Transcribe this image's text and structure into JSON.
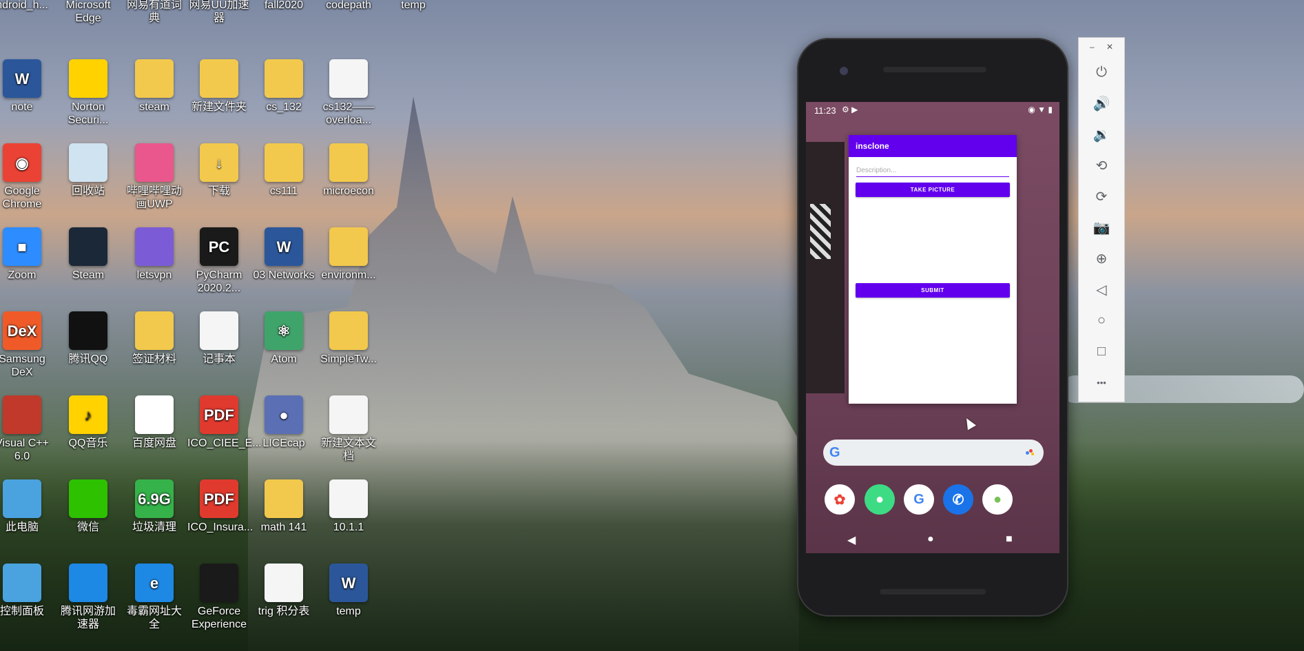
{
  "desktop": {
    "icons": [
      {
        "label": "ndroid_h...",
        "color": "#e8e8e8",
        "glyph": "",
        "col": 0,
        "row": 0
      },
      {
        "label": "Microsoft Edge",
        "color": "#0c59a4",
        "glyph": "e",
        "col": 1,
        "row": 0
      },
      {
        "label": "网易有道词典",
        "color": "#d8232a",
        "glyph": "",
        "col": 2,
        "row": 0
      },
      {
        "label": "网易UU加速器",
        "color": "#3b7dd8",
        "glyph": "",
        "col": 3,
        "row": 0
      },
      {
        "label": "fall2020",
        "color": "#f2c94c",
        "glyph": "",
        "col": 4,
        "row": 0
      },
      {
        "label": "codepath",
        "color": "#f2c94c",
        "glyph": "",
        "col": 5,
        "row": 0
      },
      {
        "label": "temp",
        "color": "#f2c94c",
        "glyph": "",
        "col": 6,
        "row": 0
      },
      {
        "label": "note",
        "color": "#2b579a",
        "glyph": "W",
        "col": 0,
        "row": 1
      },
      {
        "label": "Norton Securi...",
        "color": "#ffd200",
        "glyph": "",
        "col": 1,
        "row": 1
      },
      {
        "label": "steam",
        "color": "#f2c94c",
        "glyph": "",
        "col": 2,
        "row": 1
      },
      {
        "label": "新建文件夹",
        "color": "#f2c94c",
        "glyph": "",
        "col": 3,
        "row": 1
      },
      {
        "label": "cs_132",
        "color": "#f2c94c",
        "glyph": "",
        "col": 4,
        "row": 1
      },
      {
        "label": "cs132——overloa...",
        "color": "#f5f5f5",
        "glyph": "",
        "col": 5,
        "row": 1
      },
      {
        "label": "Google Chrome",
        "color": "#ea4335",
        "glyph": "◉",
        "col": 0,
        "row": 2
      },
      {
        "label": "回收站",
        "color": "#cfe3f1",
        "glyph": "",
        "col": 1,
        "row": 2
      },
      {
        "label": "哔哩哔哩动画UWP",
        "color": "#e9578c",
        "glyph": "",
        "col": 2,
        "row": 2
      },
      {
        "label": "下载",
        "color": "#f2c94c",
        "glyph": "↓",
        "col": 3,
        "row": 2
      },
      {
        "label": "cs111",
        "color": "#f2c94c",
        "glyph": "",
        "col": 4,
        "row": 2
      },
      {
        "label": "microecon",
        "color": "#f2c94c",
        "glyph": "",
        "col": 5,
        "row": 2
      },
      {
        "label": "Zoom",
        "color": "#2d8cff",
        "glyph": "■",
        "col": 0,
        "row": 3
      },
      {
        "label": "Steam",
        "color": "#1b2838",
        "glyph": "",
        "col": 1,
        "row": 3
      },
      {
        "label": "letsvpn",
        "color": "#7b5cd6",
        "glyph": "",
        "col": 2,
        "row": 3
      },
      {
        "label": "PyCharm 2020.2...",
        "color": "#1a1a1a",
        "glyph": "PC",
        "col": 3,
        "row": 3
      },
      {
        "label": "03 Networks",
        "color": "#2b579a",
        "glyph": "W",
        "col": 4,
        "row": 3
      },
      {
        "label": "environm...",
        "color": "#f2c94c",
        "glyph": "",
        "col": 5,
        "row": 3
      },
      {
        "label": "Samsung DeX",
        "color": "#f05a28",
        "glyph": "DeX",
        "col": 0,
        "row": 4
      },
      {
        "label": "腾讯QQ",
        "color": "#111111",
        "glyph": "",
        "col": 1,
        "row": 4
      },
      {
        "label": "签证材料",
        "color": "#f2c94c",
        "glyph": "",
        "col": 2,
        "row": 4
      },
      {
        "label": "记事本",
        "color": "#f5f5f5",
        "glyph": "",
        "col": 3,
        "row": 4
      },
      {
        "label": "Atom",
        "color": "#3fa46a",
        "glyph": "⚛",
        "col": 4,
        "row": 4
      },
      {
        "label": "SimpleTw...",
        "color": "#f2c94c",
        "glyph": "",
        "col": 5,
        "row": 4
      },
      {
        "label": "Visual C++ 6.0",
        "color": "#c0392b",
        "glyph": "",
        "col": 0,
        "row": 5
      },
      {
        "label": "QQ音乐",
        "color": "#ffd200",
        "glyph": "♪",
        "col": 1,
        "row": 5
      },
      {
        "label": "百度网盘",
        "color": "#ffffff",
        "glyph": "",
        "col": 2,
        "row": 5
      },
      {
        "label": "ICO_CIEE_E...",
        "color": "#e03a2f",
        "glyph": "PDF",
        "col": 3,
        "row": 5
      },
      {
        "label": "LICEcap",
        "color": "#5b6fb5",
        "glyph": "●",
        "col": 4,
        "row": 5
      },
      {
        "label": "新建文本文档",
        "color": "#f5f5f5",
        "glyph": "",
        "col": 5,
        "row": 5
      },
      {
        "label": "此电脑",
        "color": "#4aa3df",
        "glyph": "",
        "col": 0,
        "row": 6
      },
      {
        "label": "微信",
        "color": "#2dc100",
        "glyph": "",
        "col": 1,
        "row": 6
      },
      {
        "label": "垃圾清理",
        "color": "#36b24a",
        "glyph": "6.9G",
        "col": 2,
        "row": 6
      },
      {
        "label": "ICO_Insura...",
        "color": "#e03a2f",
        "glyph": "PDF",
        "col": 3,
        "row": 6
      },
      {
        "label": "math 141",
        "color": "#f2c94c",
        "glyph": "",
        "col": 4,
        "row": 6
      },
      {
        "label": "10.1.1",
        "color": "#f5f5f5",
        "glyph": "",
        "col": 5,
        "row": 6
      },
      {
        "label": "控制面板",
        "color": "#4aa3df",
        "glyph": "",
        "col": 0,
        "row": 7
      },
      {
        "label": "腾讯网游加速器",
        "color": "#1e88e5",
        "glyph": "",
        "col": 1,
        "row": 7
      },
      {
        "label": "毒霸网址大全",
        "color": "#1e88e5",
        "glyph": "e",
        "col": 2,
        "row": 7
      },
      {
        "label": "GeForce Experience",
        "color": "#1a1a1a",
        "glyph": "",
        "col": 3,
        "row": 7
      },
      {
        "label": "trig 积分表",
        "color": "#f5f5f5",
        "glyph": "",
        "col": 4,
        "row": 7
      },
      {
        "label": "temp",
        "color": "#2b579a",
        "glyph": "W",
        "col": 5,
        "row": 7
      }
    ]
  },
  "phone": {
    "status": {
      "time": "11:23",
      "left_icons": "⚙ ▶",
      "right_icons": "◉ ▼ ▮"
    },
    "app": {
      "title": "insclone",
      "description_placeholder": "Description...",
      "take_picture": "TAKE PICTURE",
      "submit": "SUBMIT"
    },
    "search": {
      "g": "G"
    },
    "dock": [
      {
        "name": "photos",
        "glyph": "✿",
        "color": "#ea4335"
      },
      {
        "name": "android",
        "glyph": "●",
        "color": "#3ddc84"
      },
      {
        "name": "google",
        "glyph": "G",
        "color": "#4285f4"
      },
      {
        "name": "phone",
        "glyph": "✆",
        "color": "#1a73e8"
      },
      {
        "name": "android-app",
        "glyph": "●",
        "color": "#78c257"
      }
    ],
    "nav": {
      "back": "◀",
      "home": "●",
      "recents": "■"
    }
  },
  "emulator_toolbar": {
    "minimize": "–",
    "close": "✕",
    "buttons": [
      {
        "name": "power",
        "glyph": "⏻"
      },
      {
        "name": "volume-up",
        "glyph": "🔊"
      },
      {
        "name": "volume-down",
        "glyph": "🔉"
      },
      {
        "name": "rotate-left",
        "glyph": "⟲"
      },
      {
        "name": "rotate-right",
        "glyph": "⟳"
      },
      {
        "name": "camera",
        "glyph": "📷"
      },
      {
        "name": "zoom",
        "glyph": "⊕"
      },
      {
        "name": "back",
        "glyph": "◁"
      },
      {
        "name": "home",
        "glyph": "○"
      },
      {
        "name": "overview",
        "glyph": "□"
      },
      {
        "name": "more",
        "glyph": "•••"
      }
    ]
  }
}
